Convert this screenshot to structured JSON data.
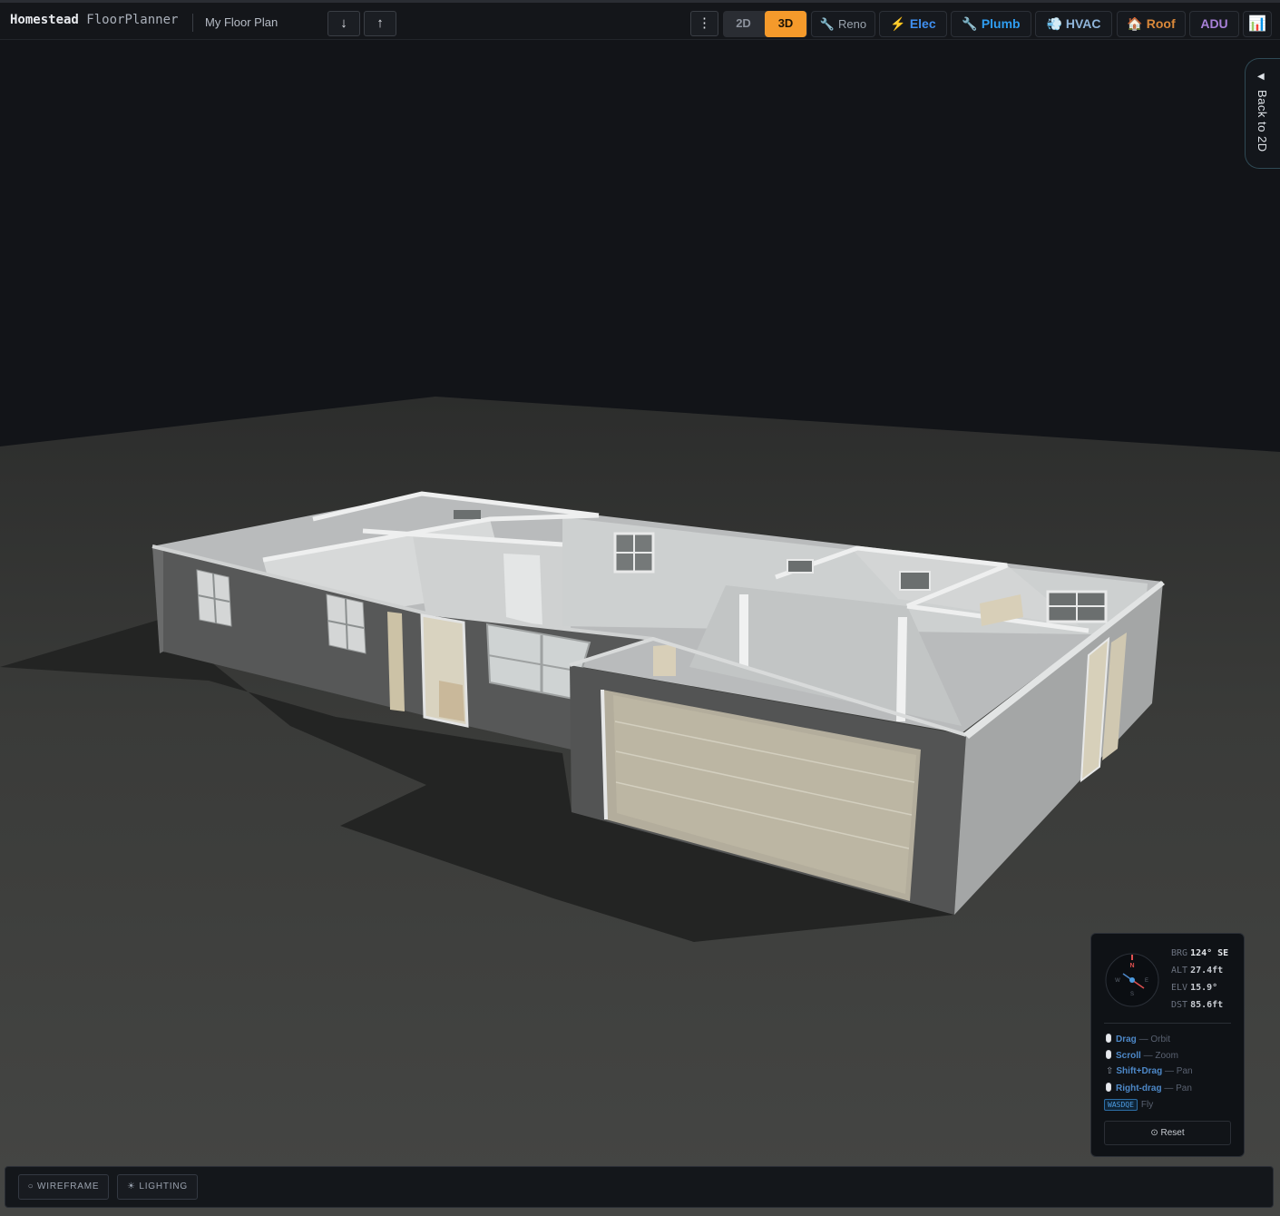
{
  "app": {
    "brand_bold": "Homestead",
    "brand_rest": "FloorPlanner",
    "plan_name": "My Floor Plan"
  },
  "toolbar": {
    "download_icon": "↓",
    "upload_icon": "↑",
    "more_icon": "⋮",
    "view_2d": "2D",
    "view_3d": "3D",
    "active_view": "3D",
    "tools": {
      "reno": {
        "icon": "🔧",
        "label": "Reno",
        "color": "#9aa3ad"
      },
      "elec": {
        "icon": "⚡",
        "label": "Elec",
        "color": "#3f8ff0"
      },
      "plumb": {
        "icon": "🔧",
        "label": "Plumb",
        "color": "#2f9df0"
      },
      "hvac": {
        "icon": "💨",
        "label": "HVAC",
        "color": "#8fb4d9"
      },
      "roof": {
        "icon": "🏠",
        "label": "Roof",
        "color": "#d9883a"
      },
      "adu": {
        "label": "ADU",
        "color": "#a880d8"
      },
      "stats_icon": "📊"
    }
  },
  "side_tab": {
    "arrow": "◀",
    "label": "Back to 2D"
  },
  "nav": {
    "compass": {
      "n": "N",
      "s": "S",
      "e": "E",
      "w": "W"
    },
    "brg_label": "BRG",
    "brg_value": "124° SE",
    "alt_label": "ALT",
    "alt_value": "27.4ft",
    "elv_label": "ELV",
    "elv_value": "15.9°",
    "dst_label": "DST",
    "dst_value": "85.6ft",
    "hints": [
      {
        "key": "Drag",
        "desc": "— Orbit"
      },
      {
        "key": "Scroll",
        "desc": "— Zoom"
      },
      {
        "key": "Shift+Drag",
        "desc": "— Pan"
      },
      {
        "key": "Right-drag",
        "desc": "— Pan"
      },
      {
        "key": "WASDQE",
        "desc": "Fly"
      }
    ],
    "shift_icon": "⇧",
    "reset_label": "⊙ Reset"
  },
  "bottom": {
    "wireframe": "○ WIREFRAME",
    "lighting": "☀ LIGHTING"
  },
  "colors": {
    "accent": "#f59a2b",
    "background": "#121418",
    "ground": "#3c3d3b"
  }
}
